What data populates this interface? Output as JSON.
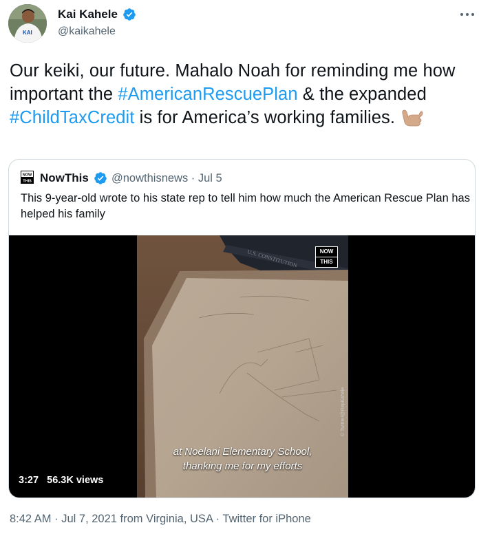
{
  "author": {
    "name": "Kai Kahele",
    "handle": "@kaikahele",
    "verified": true,
    "avatar_shirt_text": "KAI"
  },
  "tweet": {
    "text_1": "Our keiki, our future. Mahalo Noah for reminding me how important the ",
    "hashtag_1": "#AmericanRescuePlan",
    "text_2": " & the expanded ",
    "hashtag_2": "#ChildTaxCredit",
    "text_3": " is for America’s working families. ",
    "emoji": "call-me-hand-medium-light-skin-tone"
  },
  "quoted": {
    "logo_top": "NOW",
    "logo_bottom": "THIS",
    "name": "NowThis",
    "verified": true,
    "handle_date": "@nowthisnews · Jul 5",
    "text": "This 9-year-old wrote to his state rep to tell him how much the American Rescue Plan has helped his family",
    "video": {
      "badge_top": "NOW",
      "badge_bottom": "THIS",
      "book_title": "U.S. CONSTITUTION",
      "caption_line1": "at Noelani Elementary School,",
      "caption_line2": "thanking me for my efforts",
      "credit": "© Twitter/@RepKahele",
      "duration": "3:27",
      "views": "56.3K views"
    }
  },
  "footer": {
    "time": "8:42 AM",
    "separator": " · ",
    "date": "Jul 7, 2021",
    "location": " from Virginia, USA",
    "source": "Twitter for iPhone"
  },
  "colors": {
    "link": "#1d9bf0",
    "secondary_text": "#536471",
    "border": "#cfd9de"
  }
}
